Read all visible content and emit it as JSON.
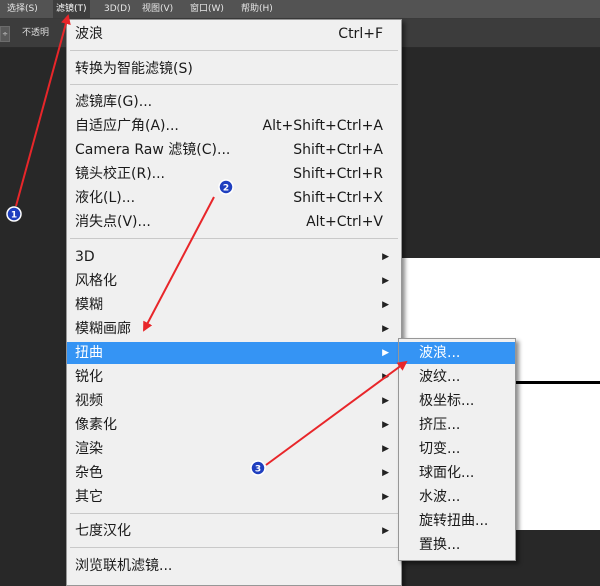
{
  "menubar": {
    "items": [
      {
        "label": "选择(S)"
      },
      {
        "label": "滤镜(T)"
      },
      {
        "label": "3D(D)"
      },
      {
        "label": "视图(V)"
      },
      {
        "label": "窗口(W)"
      },
      {
        "label": "帮助(H)"
      }
    ]
  },
  "options_bar": {
    "stepper_glyph": "÷",
    "opacity_label": "不透明"
  },
  "filter_menu": {
    "last_filter": {
      "label": "波浪",
      "shortcut": "Ctrl+F"
    },
    "convert_smart": {
      "label": "转换为智能滤镜(S)"
    },
    "gallery": [
      {
        "label": "滤镜库(G)...",
        "shortcut": ""
      },
      {
        "label": "自适应广角(A)...",
        "shortcut": "Alt+Shift+Ctrl+A"
      },
      {
        "label": "Camera Raw 滤镜(C)...",
        "shortcut": "Shift+Ctrl+A"
      },
      {
        "label": "镜头校正(R)...",
        "shortcut": "Shift+Ctrl+R"
      },
      {
        "label": "液化(L)...",
        "shortcut": "Shift+Ctrl+X"
      },
      {
        "label": "消失点(V)...",
        "shortcut": "Alt+Ctrl+V"
      }
    ],
    "categories": [
      {
        "label": "3D"
      },
      {
        "label": "风格化"
      },
      {
        "label": "模糊"
      },
      {
        "label": "模糊画廊"
      },
      {
        "label": "扭曲"
      },
      {
        "label": "锐化"
      },
      {
        "label": "视频"
      },
      {
        "label": "像素化"
      },
      {
        "label": "渲染"
      },
      {
        "label": "杂色"
      },
      {
        "label": "其它"
      }
    ],
    "plugin": {
      "label": "七度汉化"
    },
    "browse": {
      "label": "浏览联机滤镜..."
    }
  },
  "distort_submenu": {
    "items": [
      {
        "label": "波浪..."
      },
      {
        "label": "波纹..."
      },
      {
        "label": "极坐标..."
      },
      {
        "label": "挤压..."
      },
      {
        "label": "切变..."
      },
      {
        "label": "球面化..."
      },
      {
        "label": "水波..."
      },
      {
        "label": "旋转扭曲..."
      },
      {
        "label": "置换..."
      }
    ]
  },
  "annotations": {
    "badges": [
      {
        "label": "1"
      },
      {
        "label": "2"
      },
      {
        "label": "3"
      }
    ]
  },
  "colors": {
    "highlight": "#3594f4",
    "arrow": "#e8262a",
    "badge": "#1f3fbf"
  }
}
